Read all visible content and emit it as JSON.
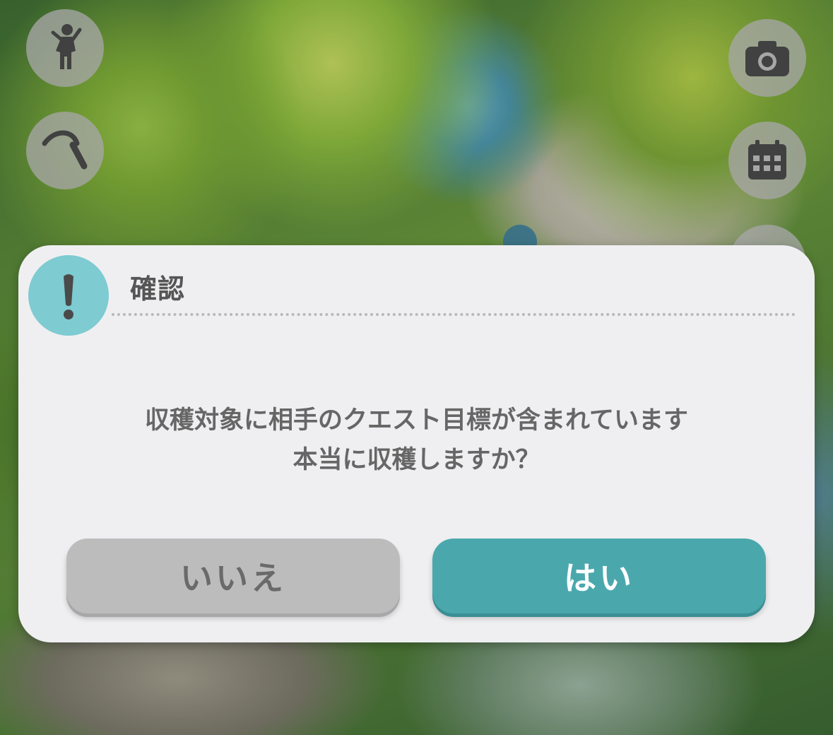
{
  "hud": {
    "left_buttons": [
      {
        "icon": "character-icon"
      },
      {
        "icon": "sickle-icon"
      }
    ],
    "right_buttons": [
      {
        "icon": "camera-icon"
      },
      {
        "icon": "calendar-icon"
      }
    ]
  },
  "dialog": {
    "title": "確認",
    "message_line1": "収穫対象に相手のクエスト目標が含まれています",
    "message_line2": "本当に収穫しますか？",
    "no_label": "いいえ",
    "yes_label": "はい",
    "colors": {
      "badge": "#7ecbd2",
      "yes_button": "#4aa8ad",
      "no_button": "#bcbcbc"
    }
  }
}
